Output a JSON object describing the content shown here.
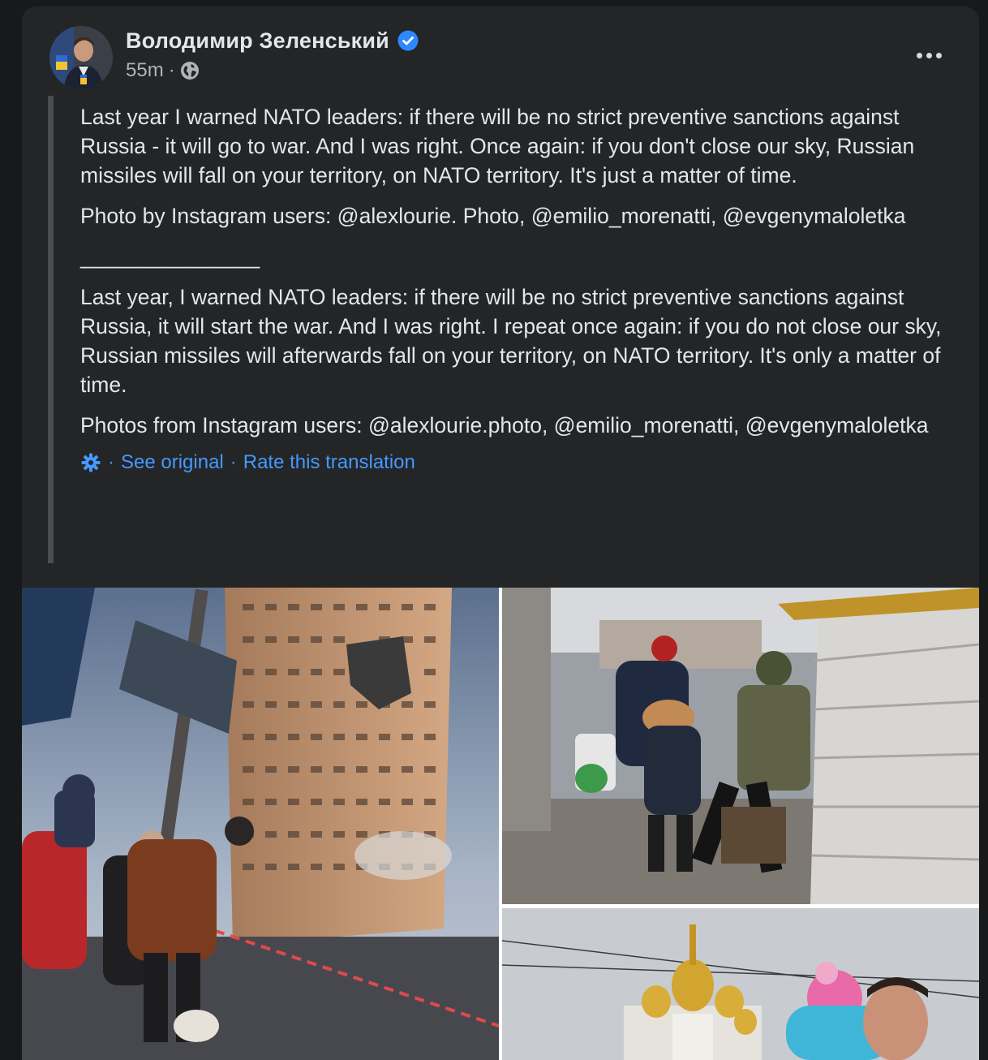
{
  "post": {
    "author": "Володимир Зеленський",
    "time": "55m",
    "dot": "·",
    "paragraphs": [
      "Last year I warned NATO leaders: if there will be no strict preventive sanctions against Russia - it will go to war. And I was right. Once again: if you don't close our sky, Russian missiles will fall on your territory, on NATO territory. It's just a matter of time.",
      "Photo by Instagram users: @alexlourie. Photo, @emilio_morenatti, @evgenymaloletka",
      "_______________",
      "Last year, I warned NATO leaders: if there will be no strict preventive sanctions against Russia, it will start the war.  And I was right.  I repeat once again: if you do not close our sky, Russian missiles will afterwards fall on your territory, on NATO territory.  It's only a matter of time.",
      "Photos from Instagram users: @alexlourie.photo, @emilio_morenatti, @evgenymaloletka"
    ],
    "translation": {
      "sep": "·",
      "see_original": "See original",
      "rate": "Rate this translation"
    }
  },
  "icons": {
    "verified": "verified-badge-icon",
    "globe": "globe-icon",
    "more": "more-options-icon",
    "gear": "gear-icon"
  },
  "photos": [
    {
      "subject": "Damaged high-rise residential building with people walking a dog on the street"
    },
    {
      "subject": "Soldier helping a family with a child cross the street"
    },
    {
      "subject": "Church with golden domes and a man carrying a child in pink hat"
    }
  ],
  "colors": {
    "link": "#4599ff",
    "verified": "#2d88ff",
    "card": "#242526"
  }
}
